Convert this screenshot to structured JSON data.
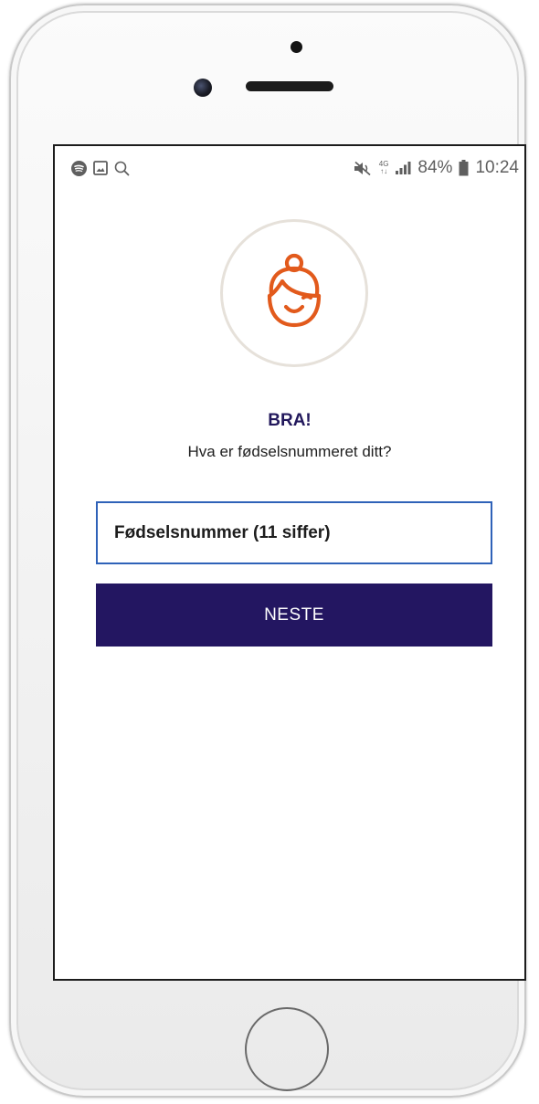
{
  "status_bar": {
    "left_icons": [
      "spotify-icon",
      "image-icon",
      "search-icon"
    ],
    "right_icons": [
      "mute-icon",
      "lte-icon",
      "signal-icon",
      "battery-icon"
    ],
    "network": "4G",
    "battery": "84%",
    "time": "10:24"
  },
  "avatar": {
    "icon": "baby-face-icon",
    "color": "#e25a1c"
  },
  "heading": "BRA!",
  "subheading": "Hva er fødselsnummeret ditt?",
  "ssn_input": {
    "placeholder": "Fødselsnummer (11 siffer)",
    "value": ""
  },
  "next_button": {
    "label": "NESTE"
  },
  "colors": {
    "primary": "#231661",
    "accent": "#e25a1c",
    "input_border": "#2f62b8"
  }
}
